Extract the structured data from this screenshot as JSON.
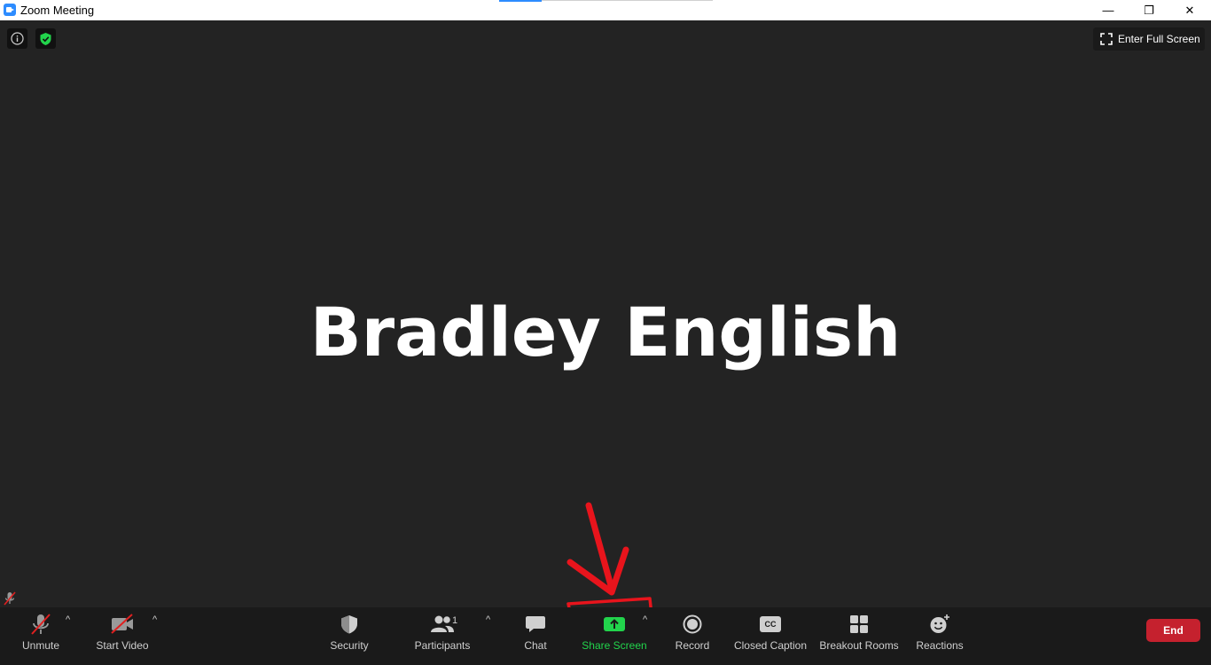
{
  "window": {
    "title": "Zoom Meeting",
    "minimize_glyph": "—",
    "maximize_glyph": "❐",
    "close_glyph": "✕"
  },
  "overlay": {
    "fullscreen_label": "Enter Full Screen"
  },
  "participant": {
    "name": "Bradley English"
  },
  "toolbar": {
    "unmute": "Unmute",
    "start_video": "Start Video",
    "security": "Security",
    "participants": "Participants",
    "participant_count": "1",
    "chat": "Chat",
    "share_screen": "Share Screen",
    "record": "Record",
    "closed_caption": "Closed Caption",
    "cc_glyph": "CC",
    "breakout_rooms": "Breakout Rooms",
    "reactions": "Reactions",
    "end": "End",
    "caret": "^"
  },
  "colors": {
    "background": "#232323",
    "toolbar": "#1a1a1a",
    "share_green": "#22d44c",
    "end_red": "#c5212e",
    "annotation_red": "#e8141c",
    "zoom_blue": "#2d8cff"
  },
  "icons": [
    "zoom-app-icon",
    "info-icon",
    "shield-check-icon",
    "fullscreen-icon",
    "mic-muted-icon",
    "video-off-icon",
    "shield-icon",
    "participants-icon",
    "chat-icon",
    "share-arrow-icon",
    "record-icon",
    "cc-icon",
    "breakout-grid-icon",
    "reaction-smile-icon"
  ]
}
